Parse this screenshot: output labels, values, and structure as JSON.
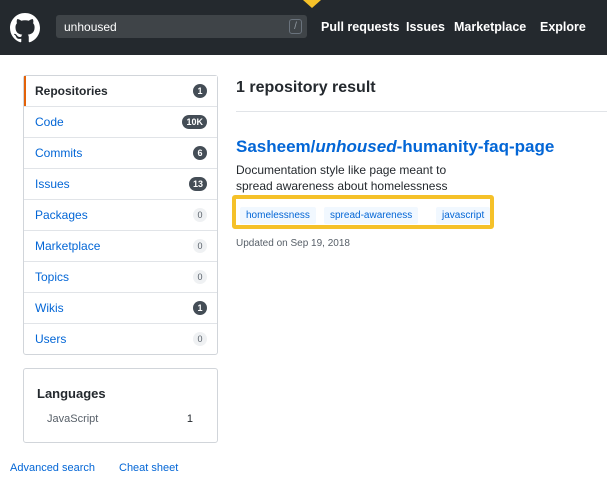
{
  "header": {
    "search": {
      "value": "unhoused",
      "shortcut": "/"
    },
    "nav": [
      "Pull requests",
      "Issues",
      "Marketplace",
      "Explore"
    ],
    "icons": {
      "logo": "github-octocat-icon",
      "marker": "pointer-triangle-icon"
    },
    "colors": {
      "background": "#24292e",
      "marker": "#f5c129"
    }
  },
  "sidebar": {
    "items": [
      {
        "label": "Repositories",
        "count": "1",
        "selected": true,
        "dark": true
      },
      {
        "label": "Code",
        "count": "10K",
        "dark": true
      },
      {
        "label": "Commits",
        "count": "6",
        "dark": true
      },
      {
        "label": "Issues",
        "count": "13",
        "dark": true
      },
      {
        "label": "Packages",
        "count": "0",
        "dark": false
      },
      {
        "label": "Marketplace",
        "count": "0",
        "dark": false
      },
      {
        "label": "Topics",
        "count": "0",
        "dark": false
      },
      {
        "label": "Wikis",
        "count": "1",
        "dark": true
      },
      {
        "label": "Users",
        "count": "0",
        "dark": false
      }
    ],
    "languages": {
      "title": "Languages",
      "items": [
        {
          "name": "JavaScript",
          "count": "1"
        }
      ]
    },
    "footer_links": [
      "Advanced search",
      "Cheat sheet"
    ]
  },
  "main": {
    "results_title": "1 repository result",
    "repo": {
      "owner_prefix": "Sasheem/",
      "highlight": "unhoused",
      "suffix": "-humanity-faq-page",
      "description": "Documentation style like page meant to spread awareness about homelessness",
      "topics": [
        "homelessness",
        "spread-awareness",
        "javascript"
      ],
      "updated": "Updated on Sep 19, 2018"
    },
    "colors": {
      "link": "#0366d6",
      "highlight_box": "#f5c129",
      "selected_accent": "#e36209"
    }
  }
}
